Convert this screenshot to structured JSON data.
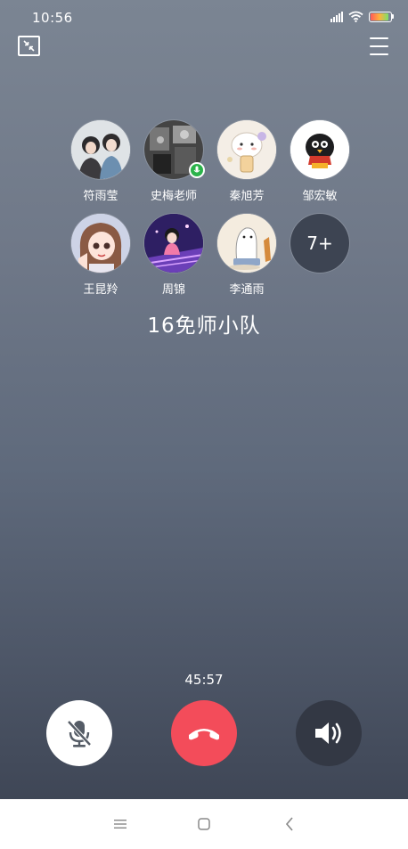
{
  "status_bar": {
    "time": "10:56",
    "battery_level": "high",
    "icons": [
      "signal-icon",
      "wifi-icon",
      "battery-icon"
    ]
  },
  "toolbar": {
    "minimize_icon": "minimize-window-icon",
    "menu_icon": "menu-icon"
  },
  "participants": [
    {
      "name": "符雨莹",
      "avatar": "photo-two-girls"
    },
    {
      "name": "史梅老师",
      "avatar": "dark-photo-collage",
      "badge": "green-mic"
    },
    {
      "name": "秦旭芳",
      "avatar": "cute-sheep-cartoon"
    },
    {
      "name": "邹宏敏",
      "avatar": "black-bird-cartoon"
    },
    {
      "name": "王昆羚",
      "avatar": "anime-girl"
    },
    {
      "name": "周锦",
      "avatar": "cartoon-girl-purple"
    },
    {
      "name": "李通雨",
      "avatar": "white-ghost-cartoon"
    }
  ],
  "more_count": "7+",
  "group_title": "16免师小队",
  "call_timer": "45:57",
  "controls": {
    "mute_icon": "mic-off-icon",
    "hangup_icon": "hangup-icon",
    "speaker_icon": "speaker-icon"
  },
  "colors": {
    "hangup": "#f34c5a",
    "mute_bg": "#ffffff",
    "speaker_bg": "#333844"
  },
  "nav": {
    "icons": [
      "recent-apps-icon",
      "home-icon",
      "back-icon"
    ]
  }
}
